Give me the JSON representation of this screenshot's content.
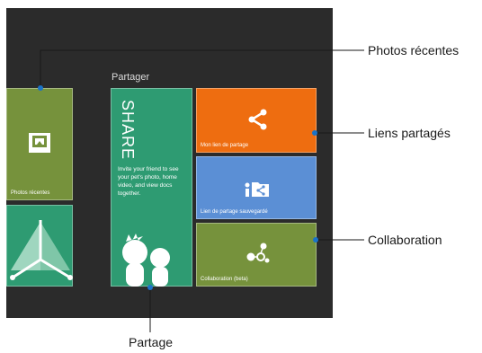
{
  "section": {
    "title": "Partager"
  },
  "tiles": {
    "photos": {
      "label": "Photos récentes",
      "color": "#76923c"
    },
    "app": {
      "color": "#2e9b72"
    },
    "share": {
      "heading": "SHARE",
      "text": "Invite your friend to see your pet's photo, home video, and view docs together.",
      "color": "#2e9b72"
    },
    "link": {
      "label": "Mon lien de partage",
      "color": "#ee6d10"
    },
    "saved": {
      "label": "Lien de partage sauvegardé",
      "color": "#5b8fd5"
    },
    "collab": {
      "label": "Collaboration (beta)",
      "color": "#76923c"
    }
  },
  "callouts": {
    "photos": "Photos récentes",
    "links": "Liens partagés",
    "collab": "Collaboration",
    "share": "Partage"
  }
}
